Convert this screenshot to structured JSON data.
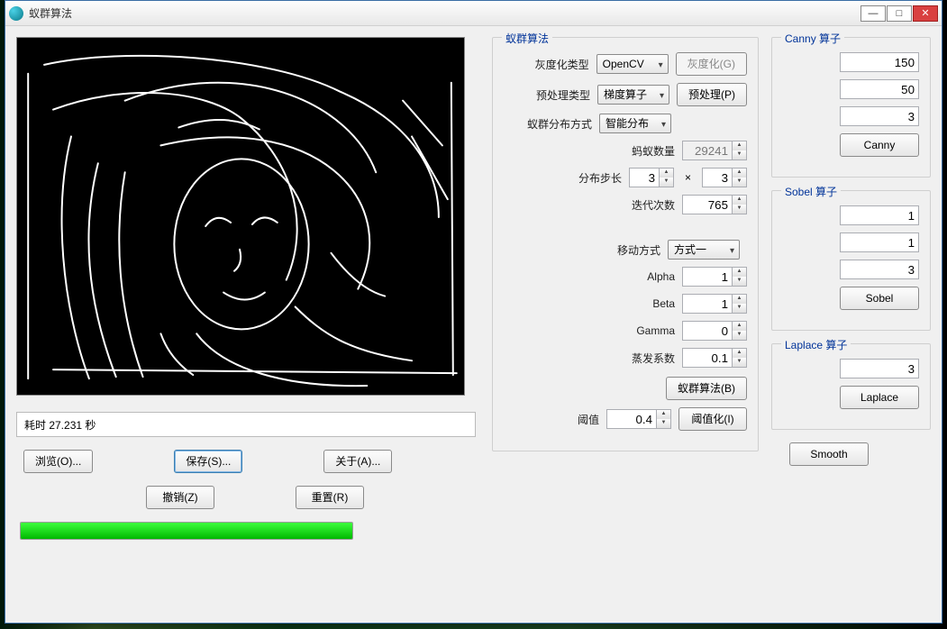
{
  "window": {
    "title": "蚁群算法"
  },
  "left": {
    "status": "耗时 27.231 秒",
    "browse": "浏览(O)...",
    "save": "保存(S)...",
    "about": "关于(A)...",
    "undo": "撤销(Z)",
    "reset": "重置(R)"
  },
  "algo": {
    "legend": "蚁群算法",
    "gray_type_label": "灰度化类型",
    "gray_type_value": "OpenCV",
    "gray_btn": "灰度化(G)",
    "pre_type_label": "预处理类型",
    "pre_type_value": "梯度算子",
    "pre_btn": "预处理(P)",
    "dist_label": "蚁群分布方式",
    "dist_value": "智能分布",
    "ant_count_label": "蚂蚁数量",
    "ant_count_value": "29241",
    "step_label": "分布步长",
    "step_x": "3",
    "step_y": "3",
    "iter_label": "迭代次数",
    "iter_value": "765",
    "move_label": "移动方式",
    "move_value": "方式一",
    "alpha_label": "Alpha",
    "alpha_value": "1",
    "beta_label": "Beta",
    "beta_value": "1",
    "gamma_label": "Gamma",
    "gamma_value": "0",
    "evap_label": "蒸发系数",
    "evap_value": "0.1",
    "run_btn": "蚁群算法(B)",
    "thresh_label": "阈值",
    "thresh_value": "0.4",
    "thresh_btn": "阈值化(I)"
  },
  "canny": {
    "legend": "Canny 算子",
    "v1": "150",
    "v2": "50",
    "v3": "3",
    "btn": "Canny"
  },
  "sobel": {
    "legend": "Sobel 算子",
    "v1": "1",
    "v2": "1",
    "v3": "3",
    "btn": "Sobel"
  },
  "laplace": {
    "legend": "Laplace 算子",
    "v1": "3",
    "btn": "Laplace"
  },
  "smooth": {
    "btn": "Smooth"
  }
}
